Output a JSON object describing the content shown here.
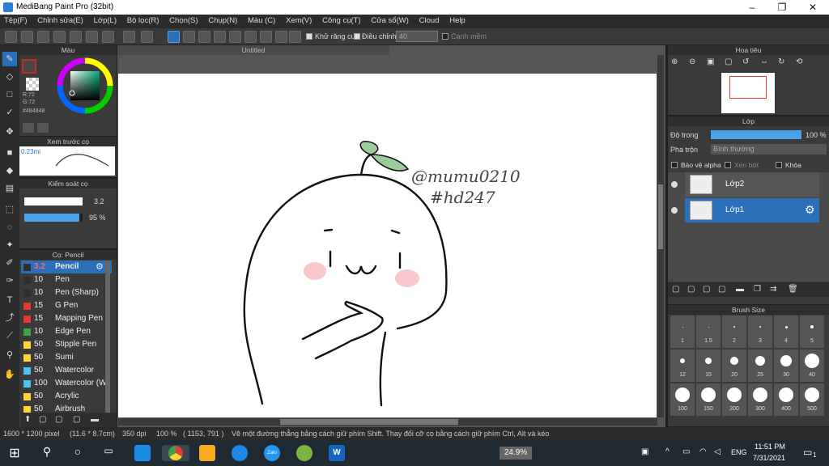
{
  "window": {
    "title": "MediBang Paint Pro (32bit)"
  },
  "menu": [
    "Tệp(F)",
    "Chỉnh sửa(E)",
    "Lớp(L)",
    "Bộ lọc(R)",
    "Chọn(S)",
    "Chụp(N)",
    "Màu (C)",
    "Xem(V)",
    "Công cụ(T)",
    "Cửa sổ(W)",
    "Cloud",
    "Help"
  ],
  "toolbar": {
    "antialias_label": "Khử răng cưa",
    "correction_label": "Điều chỉnh",
    "correction_value": "40",
    "edge_label": "Cạnh mềm"
  },
  "color_panel": {
    "title": "Màu",
    "r": "R:72",
    "g": "G:72",
    "hex": "#484848",
    "accent": "#484848"
  },
  "preview_panel": {
    "title": "Xem trước cọ",
    "size": "0.23mi"
  },
  "brush_control": {
    "title": "Kiểm soát cọ",
    "size": "3.2",
    "opacity": "95 %"
  },
  "brush_list": {
    "title": "Cọ: Pencil",
    "items": [
      {
        "size": "3.2",
        "name": "Pencil",
        "color": "#2f2f2f"
      },
      {
        "size": "10",
        "name": "Pen",
        "color": "#2f2f2f"
      },
      {
        "size": "10",
        "name": "Pen (Sharp)",
        "color": "#2f2f2f"
      },
      {
        "size": "15",
        "name": "G Pen",
        "color": "#e53935"
      },
      {
        "size": "15",
        "name": "Mapping Pen",
        "color": "#e53935"
      },
      {
        "size": "10",
        "name": "Edge Pen",
        "color": "#43a047"
      },
      {
        "size": "50",
        "name": "Stipple Pen",
        "color": "#fdd835"
      },
      {
        "size": "50",
        "name": "Sumi",
        "color": "#fdd835"
      },
      {
        "size": "50",
        "name": "Watercolor",
        "color": "#4fc3f7"
      },
      {
        "size": "100",
        "name": "Watercolor (W",
        "color": "#4fc3f7"
      },
      {
        "size": "50",
        "name": "Acrylic",
        "color": "#fdd835"
      },
      {
        "size": "50",
        "name": "Airbrush",
        "color": "#fdd835"
      }
    ]
  },
  "document": {
    "tab": "Untitled"
  },
  "drawing": {
    "text1": "@mumu0210",
    "text2": "#hd247"
  },
  "navigator": {
    "title": "Hoa tiêu"
  },
  "layer_panel": {
    "title": "Lớp",
    "opacity_label": "Độ trong",
    "opacity_value": "100 %",
    "opacity": 1.0,
    "blend_label": "Pha trộn",
    "blend_value": "Bình thường",
    "protect_alpha": "Bảo vệ alpha",
    "clipping": "Xén bớt",
    "lock": "Khóa",
    "layers": [
      "Lớp2",
      "Lớp1"
    ]
  },
  "brush_size": {
    "title": "Brush Size",
    "row1": [
      "1",
      "1.5",
      "2",
      "3",
      "4",
      "5"
    ],
    "row2": [
      "12",
      "15",
      "20",
      "25",
      "30",
      "40"
    ],
    "row3": [
      "100",
      "150",
      "200",
      "300",
      "400",
      "500"
    ]
  },
  "status": {
    "size": "1600 * 1200 pixel",
    "dims": "(11.6 * 8.7cm)",
    "dpi": "350 dpi",
    "zoom": "100 %",
    "coords": "( 1153, 791 )",
    "hint": "Vẽ một đường thẳng bằng cách giữ phím Shift. Thay đổi cỡ cọ bằng cách giữ phím Ctrl, Alt và kéo"
  },
  "taskbar": {
    "battery": "24.9%",
    "lang": "ENG",
    "time": "11:51 PM",
    "date": "7/31/2021",
    "notif": "1"
  }
}
